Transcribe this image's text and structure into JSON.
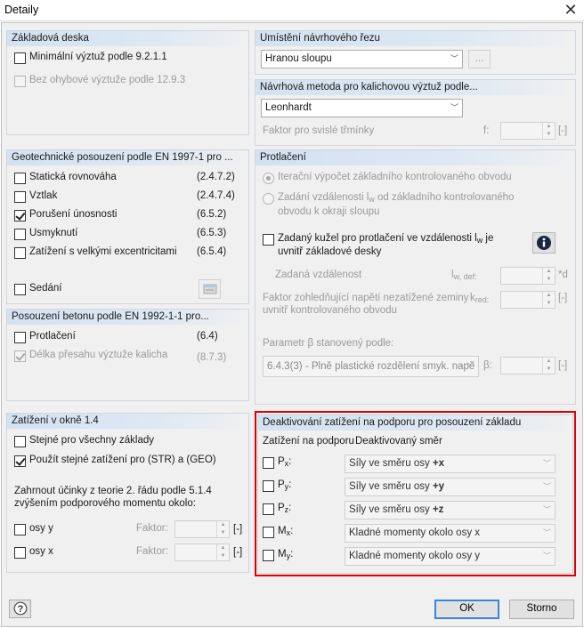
{
  "window": {
    "title": "Detaily",
    "close_glyph": "✕"
  },
  "left": {
    "basic": {
      "header": "Základová deska",
      "min_reinf": "Minimální výztuž podle 9.2.1.1",
      "no_bending": "Bez ohybové výztuže podle 12.9.3"
    },
    "geo": {
      "header": "Geotechnické posouzení podle EN 1997-1 pro ...",
      "rows": [
        {
          "label": "Statická rovnováha",
          "ref": "(2.4.7.2)",
          "checked": false
        },
        {
          "label": "Vztlak",
          "ref": "(2.4.7.4)",
          "checked": false
        },
        {
          "label": "Porušení únosnosti",
          "ref": "(6.5.2)",
          "checked": true
        },
        {
          "label": "Usmyknutí",
          "ref": "(6.5.3)",
          "checked": false
        },
        {
          "label": "Zatížení s velkými excentricitami",
          "ref": "(6.5.4)",
          "checked": false
        }
      ],
      "settlement": "Sedání"
    },
    "concrete": {
      "header": "Posouzení betonu podle EN 1992-1-1 pro...",
      "punching": "Protlačení",
      "punching_ref": "(6.4)",
      "overlap": "Délka přesahu výztuže kalicha",
      "overlap_ref": "(8.7.3)"
    },
    "loads": {
      "header": "Zatížení v okně 1.4",
      "same_all": "Stejné pro všechny základy",
      "same_str_geo": "Použít stejné zatížení pro (STR) a (GEO)",
      "second_order": "Zahrnout účinky z teorie 2. řádu podle 5.1.4 zvýšením podporového momentu okolo:",
      "axis_y": "osy y",
      "axis_x": "osy x",
      "factor_label": "Faktor:",
      "unit": "[-]"
    }
  },
  "right": {
    "section": {
      "header": "Umístění návrhového řezu",
      "value": "Hranou sloupu",
      "more": "..."
    },
    "method": {
      "header": "Návrhová metoda pro kalichovou výztuž podle...",
      "value": "Leonhardt",
      "factor": "Faktor pro svislé třmínky",
      "sym": "f:",
      "unit": "[-]"
    },
    "punching": {
      "header": "Protlačení",
      "iter": "Iterační výpočet základního kontrolovaného obvodu",
      "dist_line1": "Zadání vzdálenosti l",
      "dist_sub": "w",
      "dist_line1_end": " od základního kontrolovaného",
      "dist_line2": "obvodu k okraji sloupu",
      "cone_line1": "Zadaný kužel pro protlačení ve vzdálenosti l",
      "cone_sub": "w",
      "cone_line1_end": " je",
      "cone_line2": "uvnitř základové desky",
      "given_dist": "Zadaná vzdálenost",
      "lw_sym": "l",
      "lw_sub": "w, def:",
      "lw_unit": "*d",
      "kred_line1": "Faktor zohledňující napětí nezatížené zeminy",
      "kred_line2": "uvnitř kontrolovaného obvodu",
      "kred_sym": "k",
      "kred_sub": "red:",
      "kred_unit": "[-]",
      "beta_label": "Parametr β stanovený podle:",
      "beta_value": "6.4.3(3) - Plně plastické rozdělení smyk. napě",
      "beta_sym": "β:",
      "beta_unit": "[-]"
    },
    "deact": {
      "header": "Deaktivování zatížení na podporu pro posouzení základu",
      "col1": "Zatížení na podporu",
      "col2": "Deaktivovaný směr",
      "rows": [
        {
          "sym": "P",
          "sub": "x",
          "colon": ":",
          "pre": "Síly ve směru osy ",
          "bold": "+x"
        },
        {
          "sym": "P",
          "sub": "y",
          "colon": ":",
          "pre": "Síly ve směru osy ",
          "bold": "+y"
        },
        {
          "sym": "P",
          "sub": "z",
          "colon": ":",
          "pre": "Síly ve směru osy ",
          "bold": "+z"
        },
        {
          "sym": "M",
          "sub": "x",
          "colon": ":",
          "pre": "Kladné momenty okolo osy x",
          "bold": ""
        },
        {
          "sym": "M",
          "sub": "y",
          "colon": ":",
          "pre": "Kladné momenty okolo osy y",
          "bold": ""
        }
      ]
    }
  },
  "footer": {
    "ok": "OK",
    "cancel": "Storno"
  },
  "colors": {
    "highlight": "#e00000",
    "header_gradient": "#d3e1f1",
    "default_button": "#3a86d6"
  }
}
